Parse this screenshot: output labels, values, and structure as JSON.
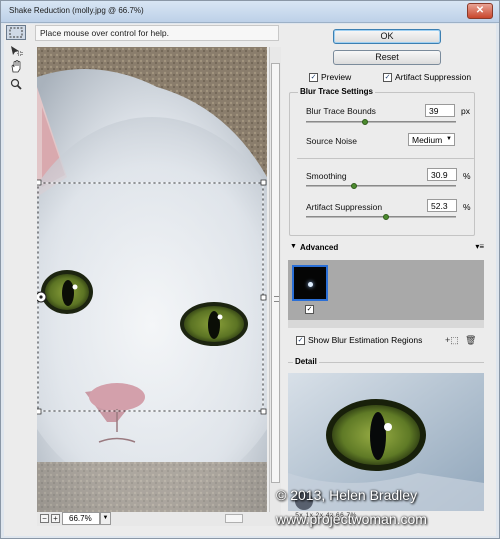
{
  "window": {
    "title": "Shake Reduction (molly.jpg @ 66.7%)",
    "close_glyph": "✕"
  },
  "tools": [
    "marquee-tool",
    "blur-trace-tool",
    "hand-tool",
    "zoom-tool"
  ],
  "help_text": "Place mouse over control for help.",
  "buttons": {
    "ok": "OK",
    "reset": "Reset"
  },
  "options": {
    "preview": {
      "label": "Preview",
      "checked": true
    },
    "artifact_suppression": {
      "label": "Artifact Suppression",
      "checked": true
    }
  },
  "blur_trace": {
    "title": "Blur Trace Settings",
    "bounds": {
      "label": "Blur Trace Bounds",
      "value": "39",
      "unit": "px"
    },
    "source_noise": {
      "label": "Source Noise",
      "value": "Medium"
    },
    "smoothing": {
      "label": "Smoothing",
      "value": "30.9",
      "unit": "%"
    },
    "artifact": {
      "label": "Artifact Suppression",
      "value": "52.3",
      "unit": "%"
    }
  },
  "advanced": {
    "title": "Advanced",
    "show_regions": {
      "label": "Show Blur Estimation Regions",
      "checked": true
    }
  },
  "detail": {
    "title": "Detail",
    "zoom_steps": ".5x    1x    2x    4x    66.7%"
  },
  "zoom": {
    "value": "66.7%",
    "minus": "−",
    "plus": "+"
  },
  "watermark": {
    "line1": "© 2013, Helen Bradley",
    "line2": "www.projectwoman.com"
  },
  "colors": {
    "accent": "#2b6fd6",
    "slider_knob": "#4c8b2f"
  }
}
